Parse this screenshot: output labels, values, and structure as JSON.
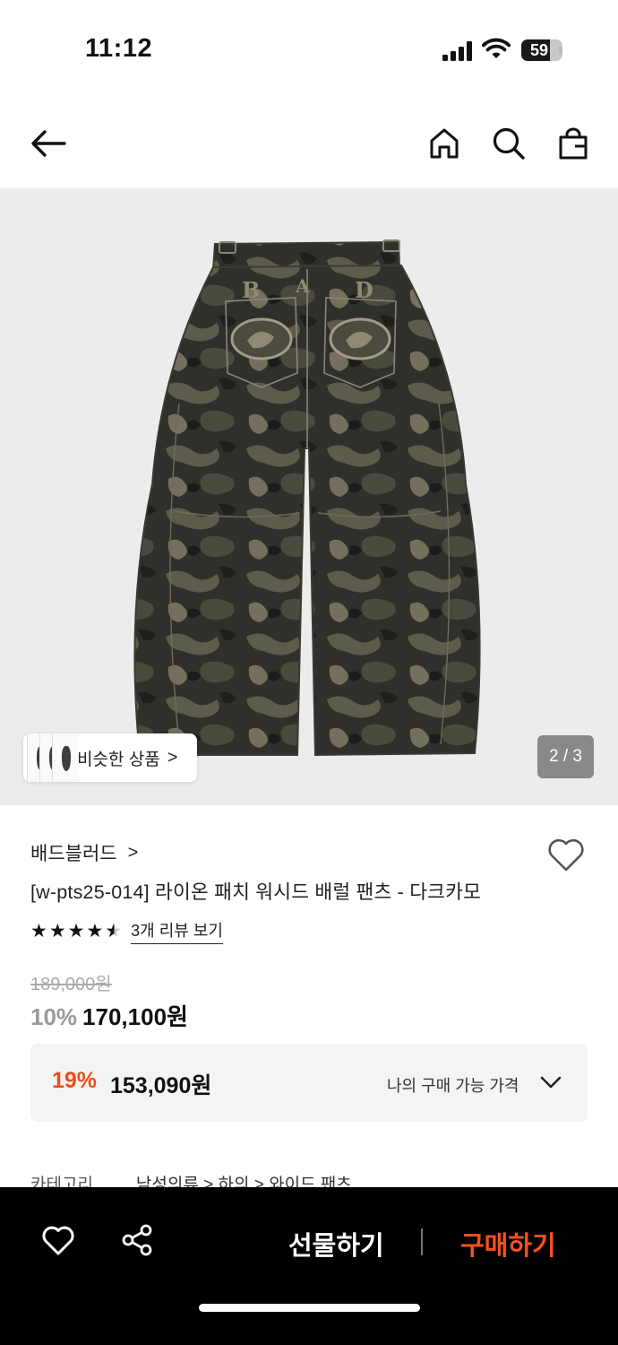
{
  "status_bar": {
    "time": "11:12",
    "battery": "59"
  },
  "nav": {
    "back_icon": "arrow-left-icon",
    "home_icon": "home-icon",
    "search_icon": "search-icon",
    "cart_icon": "shopping-bag-icon"
  },
  "gallery": {
    "similar_label": "비슷한 상품",
    "similar_chevron": ">",
    "page_indicator": "2 / 3"
  },
  "product": {
    "brand": "배드블러드",
    "brand_chevron": ">",
    "title": "[w-pts25-014] 라이온 패치 워시드 배럴 팬츠 - 다크카모",
    "rating": 4.5,
    "stars": [
      "★",
      "★",
      "★",
      "★",
      "★"
    ],
    "review_link": "3개 리뷰 보기",
    "original_price": "189,000원",
    "discount_rate": "10%",
    "price": "170,100원"
  },
  "my_price": {
    "discount_rate": "19%",
    "price": "153,090원",
    "label": "나의 구매 가능 가격"
  },
  "category": {
    "label": "카테고리",
    "path": "남성의류 > 하의 > 와이드 팬츠"
  },
  "bottom_bar": {
    "gift_label": "선물하기",
    "buy_label": "구매하기"
  },
  "colors": {
    "accent": "#ee4c1c",
    "buy": "#f5521e",
    "bar": "#000000",
    "gallery_bg": "#ececec"
  }
}
